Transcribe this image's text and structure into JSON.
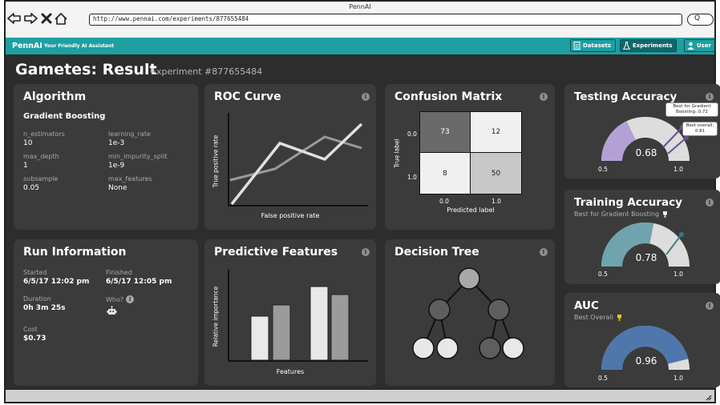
{
  "browser": {
    "title": "PennAI",
    "url": "http://www.pennai.com/experiments/877655484",
    "search_glyph": "Q"
  },
  "appbar": {
    "brand": "PennAI",
    "tagline": "Your Friendly AI Assistant",
    "nav": {
      "datasets": "Datasets",
      "experiments": "Experiments",
      "user": "User"
    }
  },
  "header": {
    "title": "Gametes: Result",
    "subtitle": "Experiment #877655484"
  },
  "algorithm": {
    "title": "Algorithm",
    "name": "Gradient Boosting",
    "params": [
      {
        "label": "n_estimators",
        "value": "10"
      },
      {
        "label": "learning_rate",
        "value": "1e-3"
      },
      {
        "label": "max_depth",
        "value": "1"
      },
      {
        "label": "min_impurity_split",
        "value": "1e-9"
      },
      {
        "label": "subsample",
        "value": "0.05"
      },
      {
        "label": "max_features",
        "value": "None"
      }
    ]
  },
  "roc": {
    "title": "ROC Curve",
    "xlabel": "False positive rate",
    "ylabel": "True positive rate"
  },
  "confusion": {
    "title": "Confusion Matrix",
    "row_labels": [
      "0.0",
      "1.0"
    ],
    "col_labels": [
      "0.0",
      "1.0"
    ],
    "cells": [
      "73",
      "12",
      "8",
      "50"
    ],
    "xlabel": "Predicted label",
    "ylabel": "True label"
  },
  "testing": {
    "title": "Testing Accuracy",
    "value": "0.68",
    "min_label": "0.5",
    "max_label": "1.0",
    "tip_gradient": "Best for Gradient Boosting: 0.72",
    "tip_overall": "Best overall: 0.81",
    "color": "#b4a1d4"
  },
  "training": {
    "title": "Training Accuracy",
    "subtitle": "Best for Gradient Boosting",
    "value": "0.78",
    "min_label": "0.5",
    "max_label": "1.0",
    "color": "#6fa3ad"
  },
  "auc": {
    "title": "AUC",
    "subtitle": "Best Overall",
    "value": "0.96",
    "min_label": "0.5",
    "max_label": "1.0",
    "color": "#4f77ab"
  },
  "run": {
    "title": "Run Information",
    "started_label": "Started",
    "started": "6/5/17 12:02 pm",
    "finished_label": "Finished",
    "finished": "6/5/17 12:05 pm",
    "duration_label": "Duration",
    "duration": "0h 3m 25s",
    "who_label": "Who?",
    "cost_label": "Cost",
    "cost": "$0.73"
  },
  "features": {
    "title": "Predictive Features",
    "xlabel": "Features",
    "ylabel": "Relative importance"
  },
  "tree": {
    "title": "Decision Tree"
  }
}
